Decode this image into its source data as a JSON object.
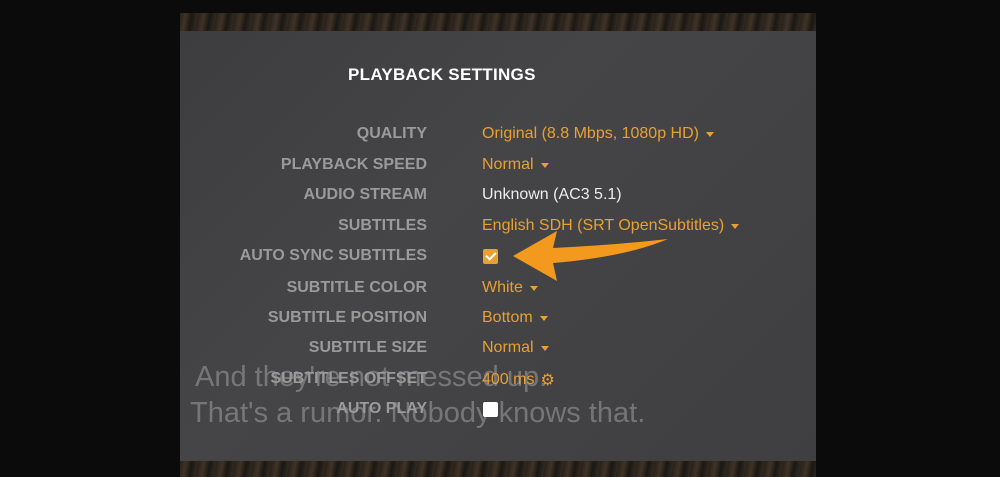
{
  "dialog": {
    "title": "PLAYBACK SETTINGS"
  },
  "settings": {
    "quality": {
      "label": "QUALITY",
      "value": "Original (8.8 Mbps, 1080p HD)"
    },
    "playback_speed": {
      "label": "PLAYBACK SPEED",
      "value": "Normal"
    },
    "audio_stream": {
      "label": "AUDIO STREAM",
      "value": "Unknown (AC3 5.1)"
    },
    "subtitles": {
      "label": "SUBTITLES",
      "value": "English SDH (SRT OpenSubtitles)"
    },
    "auto_sync_subtitles": {
      "label": "AUTO SYNC SUBTITLES",
      "checked": true
    },
    "subtitle_color": {
      "label": "SUBTITLE COLOR",
      "value": "White"
    },
    "subtitle_position": {
      "label": "SUBTITLE POSITION",
      "value": "Bottom"
    },
    "subtitle_size": {
      "label": "SUBTITLE SIZE",
      "value": "Normal"
    },
    "subtitles_offset": {
      "label": "SUBTITLES OFFSET",
      "value": "400 ms"
    },
    "auto_play": {
      "label": "AUTO PLAY",
      "checked": false
    }
  },
  "background_subtitle": {
    "line1": "And they're not messed up.",
    "line2": "That's a rumor. Nobody knows that."
  },
  "colors": {
    "accent": "#e8a033",
    "panel": "#414143",
    "label": "#9a9a9a",
    "value_plain": "#ececec",
    "annotation_arrow": "#f39a1e"
  },
  "icons": {
    "dropdown": "caret-down-icon",
    "offset_settings": "gear-icon",
    "annotation": "arrow-left-icon"
  }
}
